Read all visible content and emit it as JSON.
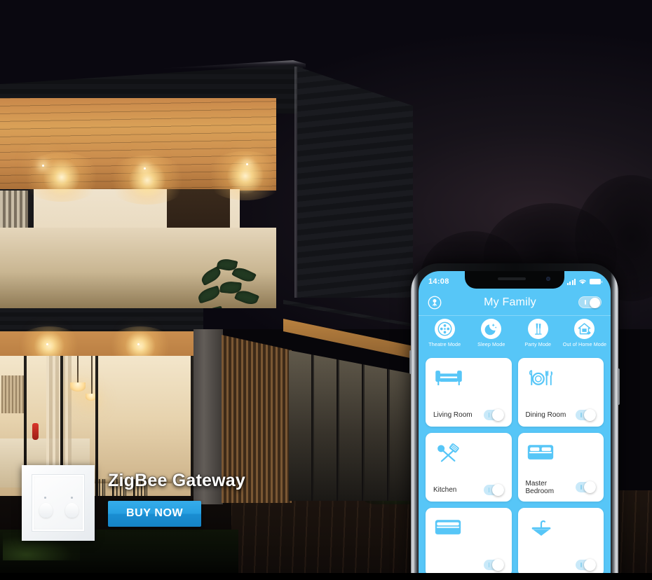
{
  "promo": {
    "title": "ZigBee Gateway",
    "cta_label": "BUY NOW",
    "cta_color": "#27a0e2",
    "product_thumb_name": "white-2-gang-wall-switch"
  },
  "scene": {
    "description": "modern two-storey house at night with warm interior lighting",
    "sky_color": "#0a0810",
    "wood_color": "#d9a057",
    "interior_glow_color": "#ffdd9a"
  },
  "phone": {
    "frame_color": "#0b0c0e",
    "accent_color": "#57c6f7",
    "status_bar": {
      "time": "14:08",
      "signal_icon": "signal-bars-icon",
      "wifi_icon": "wifi-icon",
      "battery_icon": "battery-icon"
    },
    "app": {
      "header": {
        "avatar_icon": "user-avatar-icon",
        "title": "My Family",
        "master_toggle": {
          "state": "on",
          "track_color": "#a8ddf5"
        }
      },
      "modes": [
        {
          "label": "Theatre Mode",
          "icon": "theatre-mode-icon"
        },
        {
          "label": "Sleep Mode",
          "icon": "sleep-mode-icon"
        },
        {
          "label": "Party Mode",
          "icon": "party-mode-icon"
        },
        {
          "label": "Out of Home Mode",
          "icon": "out-of-home-mode-icon"
        }
      ],
      "rooms": [
        {
          "name": "Living Room",
          "icon": "sofa-icon",
          "toggle_state": "on"
        },
        {
          "name": "Dining Room",
          "icon": "plate-cutlery-icon",
          "toggle_state": "on"
        },
        {
          "name": "Kitchen",
          "icon": "spatula-utensils-icon",
          "toggle_state": "on"
        },
        {
          "name": "Master Bedroom",
          "icon": "bed-icon",
          "toggle_state": "on"
        },
        {
          "name": "",
          "icon": "bed-icon",
          "toggle_state": "on"
        },
        {
          "name": "",
          "icon": "sink-icon",
          "toggle_state": "on"
        }
      ]
    }
  }
}
